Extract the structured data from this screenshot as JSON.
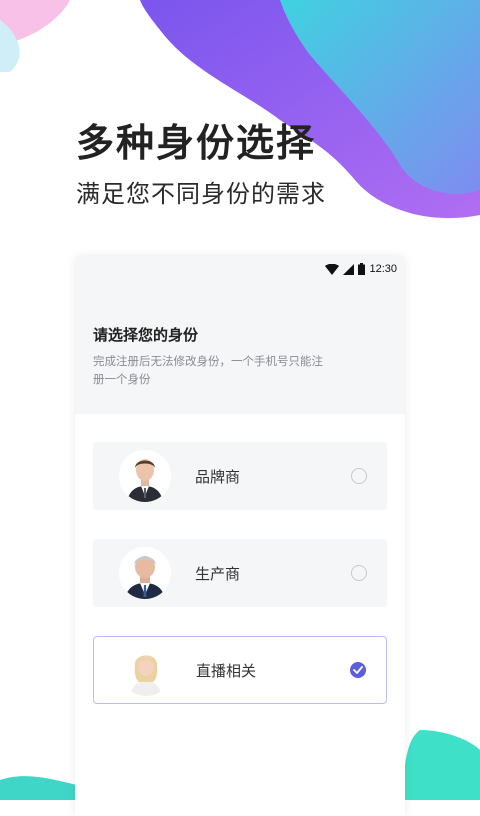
{
  "promo": {
    "headline": "多种身份选择",
    "subline": "满足您不同身份的需求"
  },
  "status_bar": {
    "time": "12:30"
  },
  "screen": {
    "title": "请选择您的身份",
    "description": "完成注册后无法修改身份，一个手机号只能注册一个身份"
  },
  "options": [
    {
      "label": "品牌商",
      "selected": false,
      "avatar": "man-in-suit-avatar"
    },
    {
      "label": "生产商",
      "selected": false,
      "avatar": "older-man-avatar"
    },
    {
      "label": "直播相关",
      "selected": true,
      "avatar": "woman-avatar"
    }
  ],
  "colors": {
    "accent": "#5b5fdc",
    "blob_purple": "#8a5cf0",
    "blob_cyan": "#3fd6d8",
    "blob_pink": "#f7b6e6"
  }
}
